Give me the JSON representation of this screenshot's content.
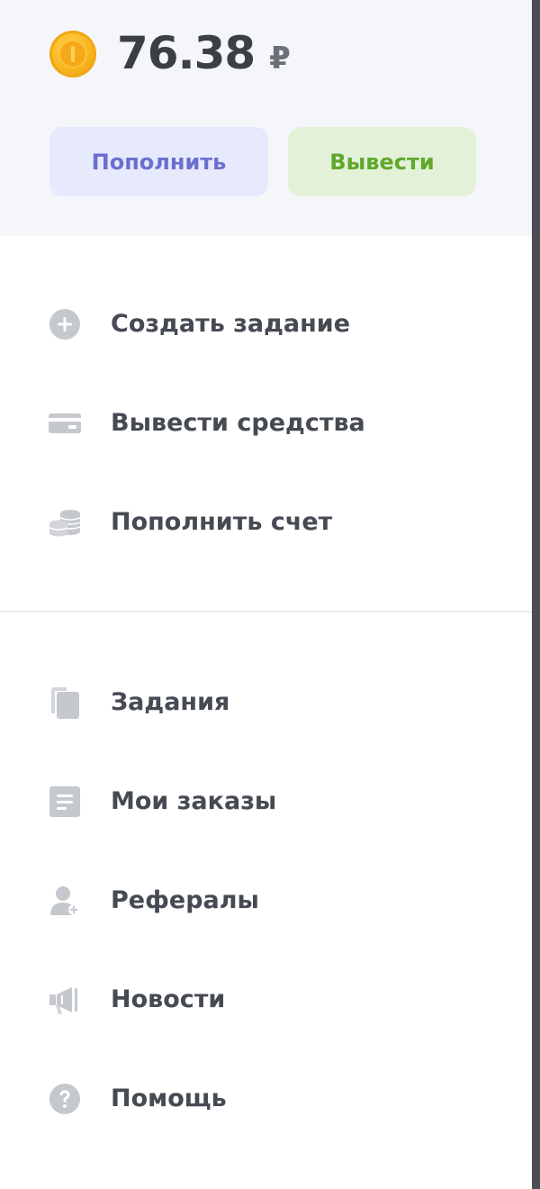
{
  "balance": {
    "amount": "76.38",
    "currency": "₽"
  },
  "actions": {
    "deposit_label": "Пополнить",
    "withdraw_label": "Вывести"
  },
  "menu": {
    "primary": [
      {
        "label": "Создать задание",
        "icon": "plus-circle-icon"
      },
      {
        "label": "Вывести средства",
        "icon": "card-icon"
      },
      {
        "label": "Пополнить счет",
        "icon": "coins-stack-icon"
      }
    ],
    "secondary": [
      {
        "label": "Задания",
        "icon": "copy-icon"
      },
      {
        "label": "Мои заказы",
        "icon": "document-icon"
      },
      {
        "label": "Рефералы",
        "icon": "user-add-icon"
      },
      {
        "label": "Новости",
        "icon": "megaphone-icon"
      },
      {
        "label": "Помощь",
        "icon": "help-circle-icon"
      }
    ]
  },
  "colors": {
    "header_bg": "#f5f6fa",
    "icon_gray": "#c5c8cd",
    "text": "#464a52",
    "deposit_bg": "#e7e9fd",
    "deposit_text": "#6a6fce",
    "withdraw_bg": "#e4f1d9",
    "withdraw_text": "#5fa82b",
    "coin": "#f7b51f"
  }
}
